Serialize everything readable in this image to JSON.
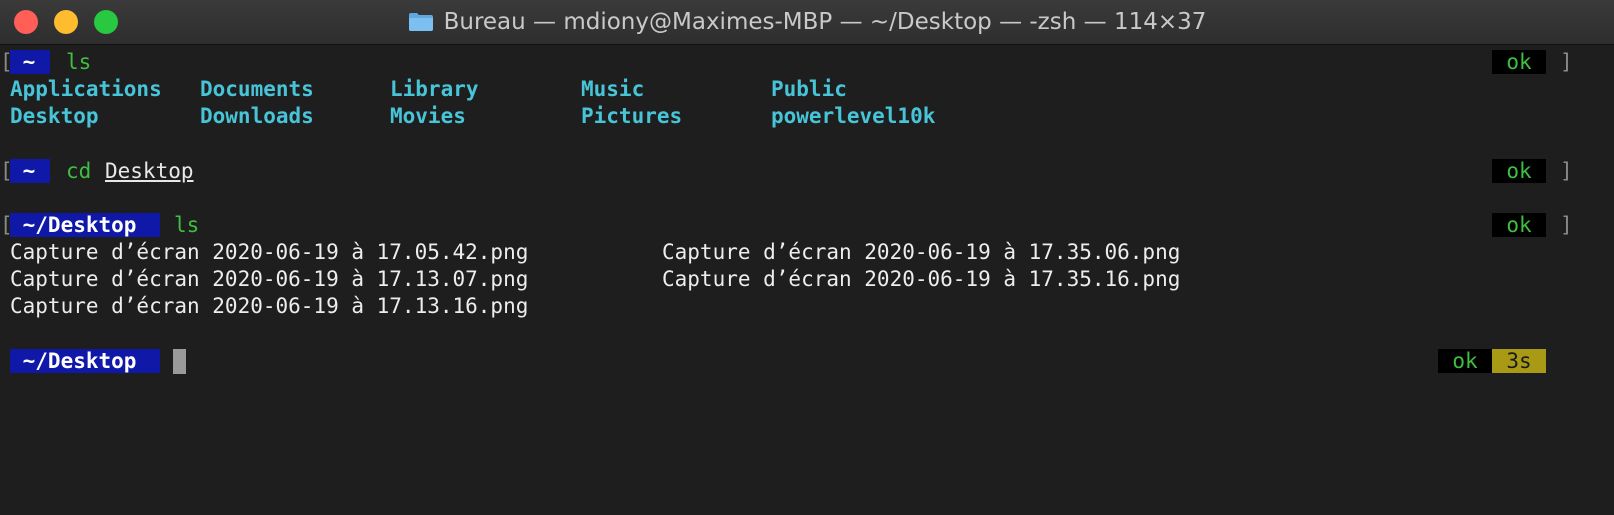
{
  "window": {
    "title": "Bureau — mdiony@Maximes-MBP — ~/Desktop — -zsh — 114×37"
  },
  "prompt1": {
    "bracket_left": "[",
    "dir": " ~ ",
    "command": "ls",
    "status": "ok",
    "bracket_right": "]"
  },
  "ls1": {
    "row1": [
      "Applications",
      "Documents",
      "Library",
      "Music",
      "Public"
    ],
    "row2": [
      "Desktop",
      "Downloads",
      "Movies",
      "Pictures",
      "powerlevel10k"
    ]
  },
  "prompt2": {
    "bracket_left": "[",
    "dir": " ~ ",
    "command": "cd",
    "argument": "Desktop",
    "status": "ok",
    "bracket_right": "]"
  },
  "prompt3": {
    "bracket_left": "[",
    "dir": " ~/Desktop ",
    "command": "ls",
    "status": "ok",
    "bracket_right": "]"
  },
  "ls2": {
    "row1": [
      "Capture d’écran 2020-06-19 à 17.05.42.png",
      "Capture d’écran 2020-06-19 à 17.35.06.png"
    ],
    "row2": [
      "Capture d’écran 2020-06-19 à 17.13.07.png",
      "Capture d’écran 2020-06-19 à 17.35.16.png"
    ],
    "row3": [
      "Capture d’écran 2020-06-19 à 17.13.16.png"
    ]
  },
  "prompt4": {
    "dir": " ~/Desktop ",
    "status": "ok",
    "duration": "3s"
  },
  "colors": {
    "dir_badge": "#1018a8",
    "command": "#3fbf3f",
    "ls_directory": "#48c4d8",
    "duration_badge": "#a89a14"
  }
}
